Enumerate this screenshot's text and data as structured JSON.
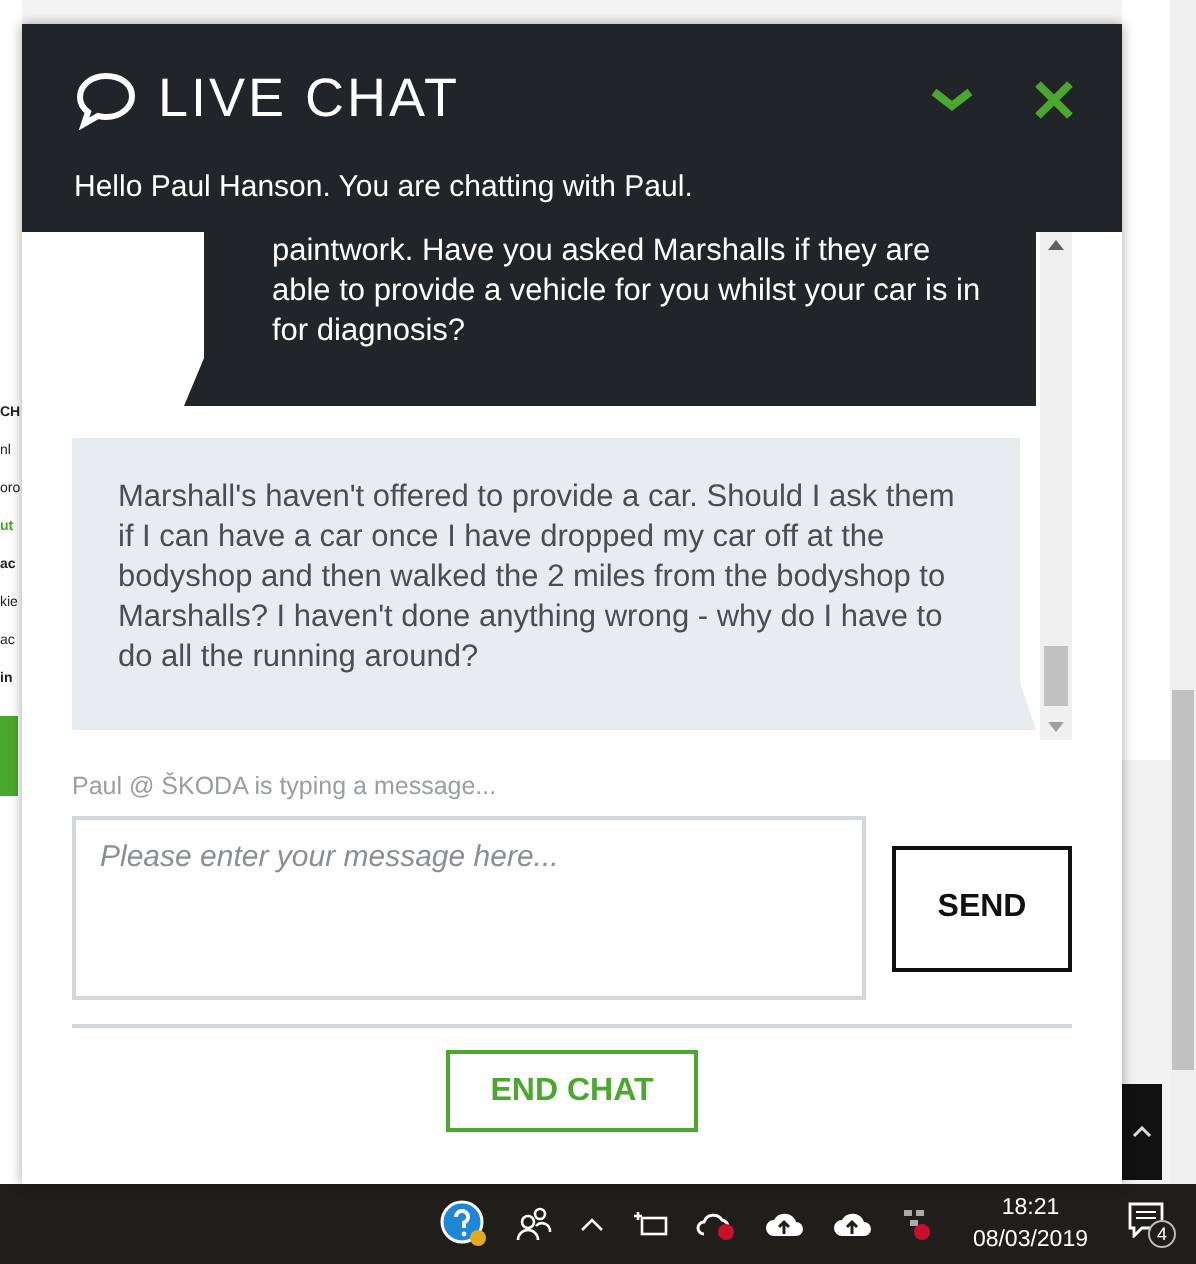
{
  "header": {
    "title": "LIVE CHAT",
    "greeting": "Hello Paul Hanson. You are chatting with Paul."
  },
  "messages": [
    {
      "kind": "agent",
      "text": "paintwork. Have you asked Marshalls if they are able to provide a vehicle for you whilst your car is in for diagnosis?"
    },
    {
      "kind": "user",
      "text": "Marshall's haven't offered to provide a car. Should I ask them if I can have a car once I have dropped my car off at the bodyshop and then walked the 2 miles from the bodyshop to Marshalls? I haven't done anything wrong - why do I have to do all the running around?"
    }
  ],
  "typing_status": "Paul @ ŠKODA is typing a message...",
  "message_field": {
    "placeholder": "Please enter your message here..."
  },
  "send_button": "SEND",
  "end_chat_button": "END CHAT",
  "background_fragments": [
    {
      "text": "CH",
      "kind": "heading"
    },
    {
      "text": "nl",
      "kind": "body"
    },
    {
      "text": "oro",
      "kind": "body"
    },
    {
      "text": "ut",
      "kind": "link"
    },
    {
      "text": "ac",
      "kind": "heading"
    },
    {
      "text": "kie",
      "kind": "body"
    },
    {
      "text": "ac",
      "kind": "body"
    },
    {
      "text": "in",
      "kind": "heading"
    }
  ],
  "taskbar": {
    "time": "18:21",
    "date": "08/03/2019",
    "notification_count": "4"
  }
}
